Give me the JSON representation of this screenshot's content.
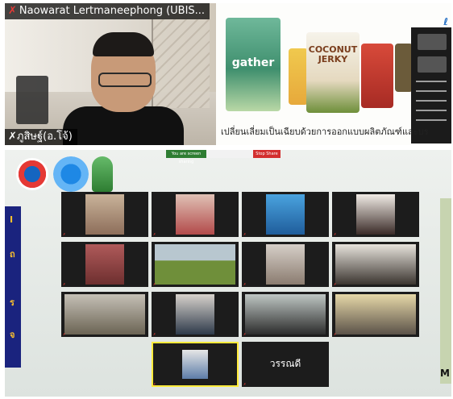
{
  "top_left": {
    "participant_name": "Naowarat Lertmaneephong (UBIS...",
    "speaker_label": "ภูสิษฐ์(อ.โจ้)"
  },
  "top_right": {
    "bag1_label": "gather",
    "bag3_label": "COCONUT JERKY",
    "caption": "เปลี่ยนเลี่ยมเป็นเฉียบด้วยการออกแบบผลิตภัณฑ์และบร"
  },
  "gallery": {
    "share_banner": "You are screen sharing",
    "stop_share": "Stop Share",
    "rightbar_letter": "M",
    "tile_names": [
      "",
      "",
      "",
      "",
      "",
      "",
      "",
      "",
      "",
      "",
      "",
      "",
      "",
      "วรรณดี"
    ]
  },
  "colors": {
    "stop_share": "#d32f2f",
    "screen_share_banner": "#2e7d32",
    "mic_muted": "#e53935",
    "tile_bg": "#1c1c1c"
  }
}
